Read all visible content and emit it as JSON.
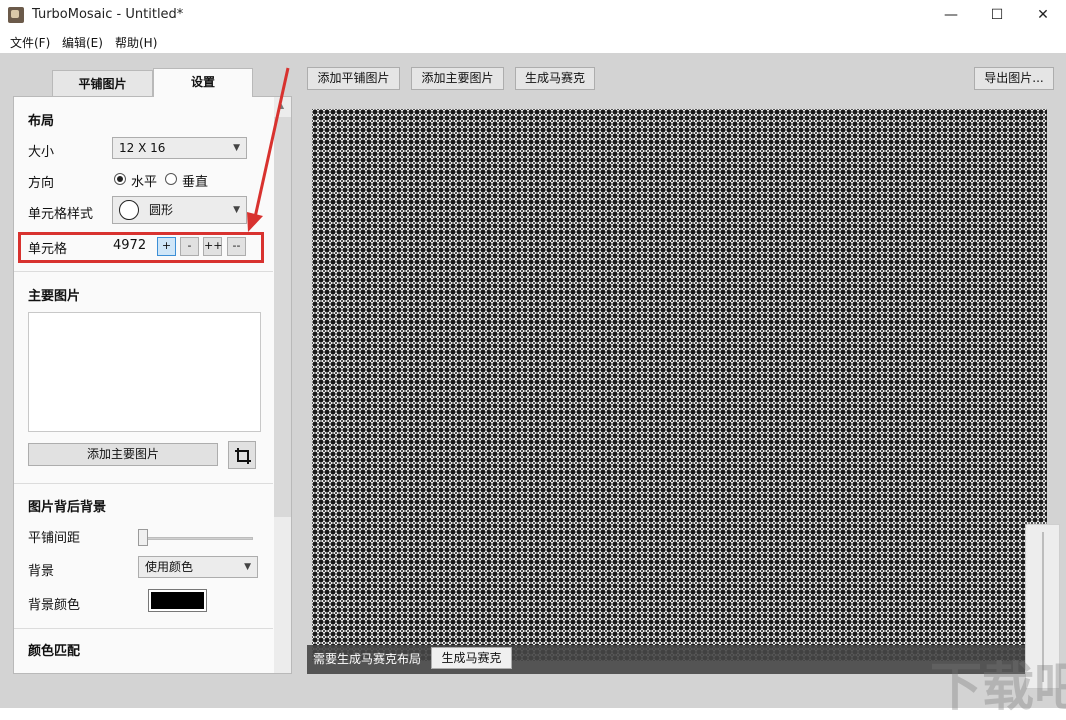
{
  "window": {
    "title": "TurboMosaic - Untitled*",
    "minimize_glyph": "—",
    "maximize_glyph": "☐",
    "close_glyph": "✕"
  },
  "menu": [
    "文件(F)",
    "编辑(E)",
    "帮助(H)"
  ],
  "tabs": {
    "tiles": "平铺图片",
    "settings": "设置"
  },
  "layout": {
    "title": "布局",
    "size_label": "大小",
    "size_value": "12 X 16",
    "orientation_label": "方向",
    "orientation_options": [
      {
        "label": "水平",
        "selected": true
      },
      {
        "label": "垂直",
        "selected": false
      }
    ],
    "cell_style_label": "单元格样式",
    "cell_style_value": "圆形",
    "cells_label": "单元格",
    "cells_value": "4972",
    "cell_buttons": [
      "+",
      "-",
      "++",
      "--"
    ]
  },
  "main_image": {
    "title": "主要图片",
    "add_button": "添加主要图片",
    "crop_icon": "crop-icon"
  },
  "background": {
    "title": "图片背后背景",
    "spacing_label": "平铺间距",
    "spacing_value": 0,
    "background_label": "背景",
    "background_value": "使用颜色",
    "bg_color_label": "背景颜色",
    "bg_color": "#000000"
  },
  "color_match": {
    "title": "颜色匹配"
  },
  "toolbar": {
    "add_tiles": "添加平铺图片",
    "add_main": "添加主要图片",
    "generate": "生成马赛克",
    "export": "导出图片..."
  },
  "status": {
    "message": "需要生成马赛克布局",
    "generate_button": "生成马赛克"
  },
  "colors": {
    "highlight": "#d8322f",
    "canvas": "#1b1b1b",
    "app_bg": "#d3d3d3"
  },
  "watermark": "下载吧"
}
